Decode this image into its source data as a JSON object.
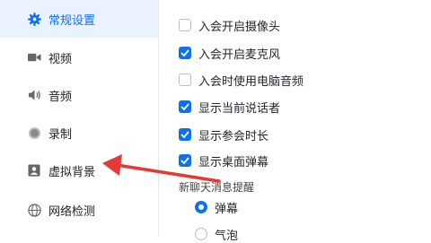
{
  "colors": {
    "accent": "#0e71eb",
    "arrow": "#e53935",
    "active_bg": "#eaf1ff"
  },
  "sidebar": {
    "items": [
      {
        "label": "常规设置",
        "icon": "gear-icon",
        "active": true
      },
      {
        "label": "视频",
        "icon": "video-camera-icon",
        "active": false
      },
      {
        "label": "音频",
        "icon": "speaker-icon",
        "active": false
      },
      {
        "label": "录制",
        "icon": "record-icon",
        "active": false
      },
      {
        "label": "虚拟背景",
        "icon": "portrait-icon",
        "active": false
      },
      {
        "label": "网络检测",
        "icon": "globe-icon",
        "active": false
      }
    ]
  },
  "settings": {
    "checkboxes": [
      {
        "label": "入会开启摄像头",
        "checked": false
      },
      {
        "label": "入会开启麦克风",
        "checked": true
      },
      {
        "label": "入会时使用电脑音频",
        "checked": false
      },
      {
        "label": "显示当前说话者",
        "checked": true
      },
      {
        "label": "显示参会时长",
        "checked": true
      },
      {
        "label": "显示桌面弹幕",
        "checked": true
      }
    ],
    "message_section_label": "新聊天消息提醒",
    "radios": [
      {
        "label": "弹幕",
        "checked": true
      },
      {
        "label": "气泡",
        "checked": false
      }
    ]
  }
}
